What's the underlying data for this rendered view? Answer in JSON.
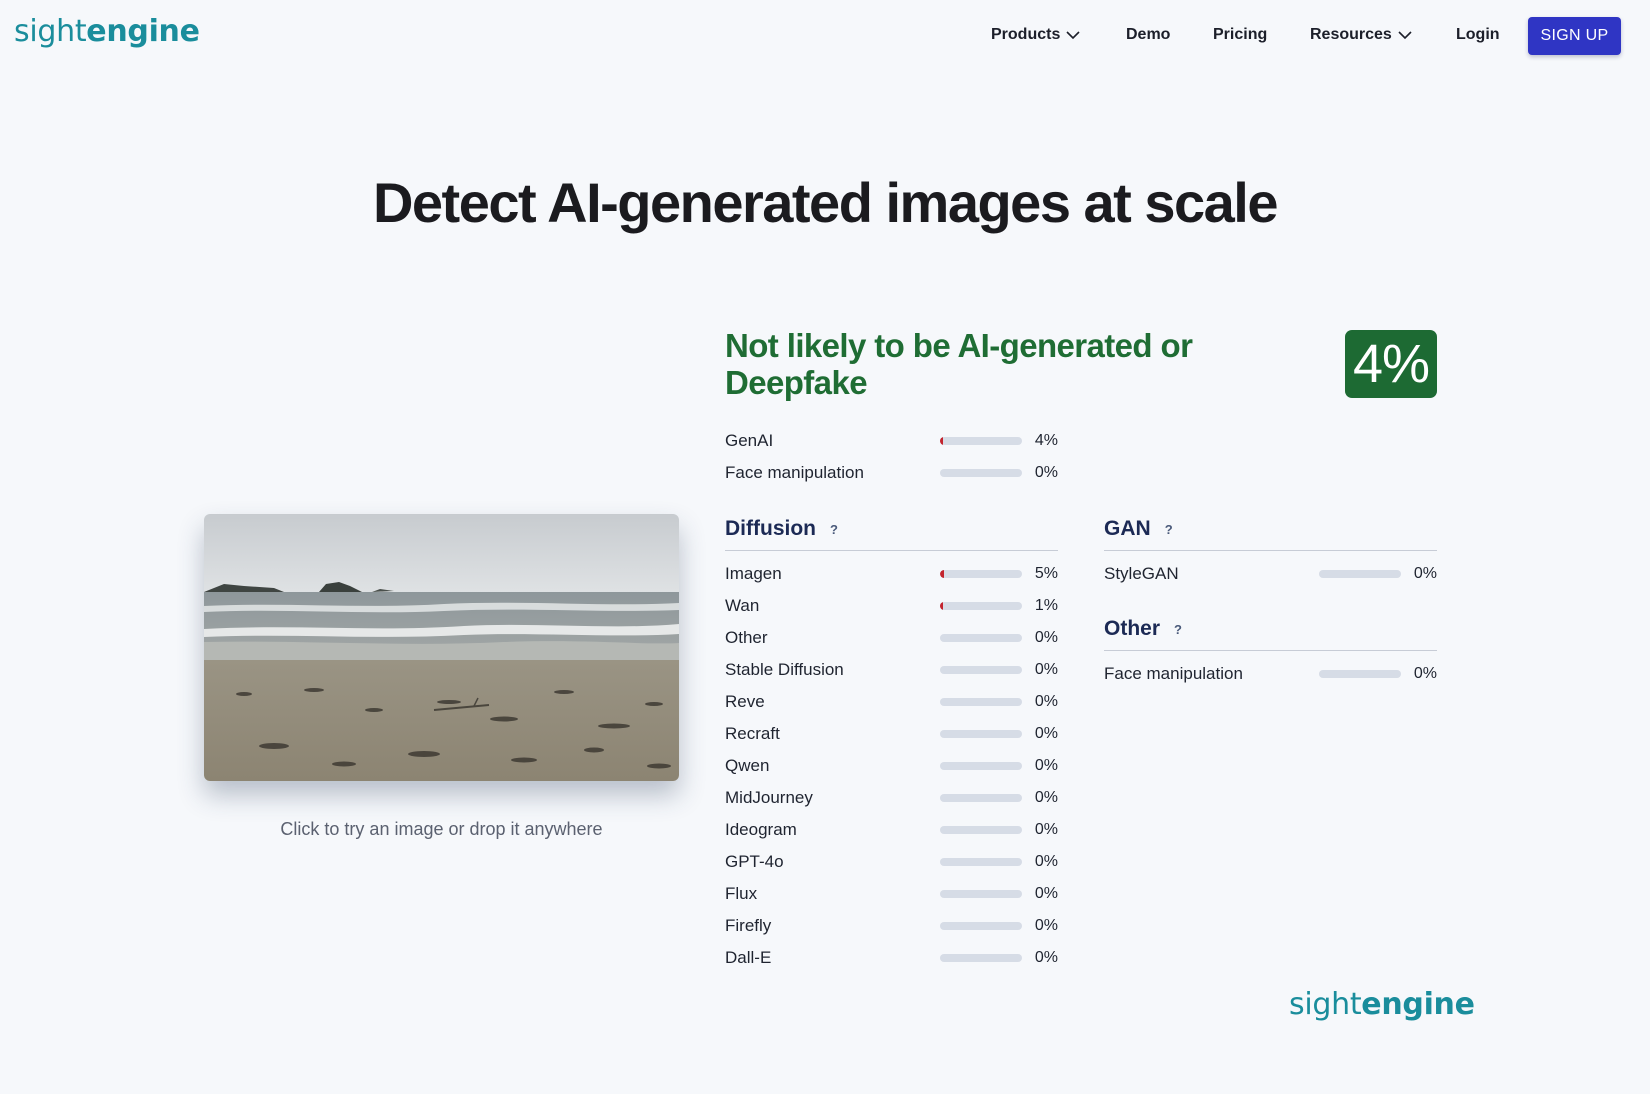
{
  "brand": {
    "logo_part1": "sight",
    "logo_part2": "engine"
  },
  "nav": {
    "products": "Products",
    "demo": "Demo",
    "pricing": "Pricing",
    "resources": "Resources",
    "login": "Login",
    "signup": "SIGN UP"
  },
  "hero": {
    "title": "Detect AI-generated images at scale"
  },
  "upload": {
    "caption": "Click to try an image or drop it anywhere"
  },
  "result": {
    "verdict": "Not likely to be AI-generated or Deepfake",
    "score": "4%",
    "verdict_color": "#1f6d34",
    "summary": [
      {
        "label": "GenAI",
        "pct": "4%",
        "value": 0.04
      },
      {
        "label": "Face manipulation",
        "pct": "0%",
        "value": 0
      }
    ],
    "diffusion": {
      "title": "Diffusion",
      "help": "?",
      "items": [
        {
          "label": "Imagen",
          "pct": "5%",
          "value": 0.05
        },
        {
          "label": "Wan",
          "pct": "1%",
          "value": 0.01
        },
        {
          "label": "Other",
          "pct": "0%",
          "value": 0
        },
        {
          "label": "Stable Diffusion",
          "pct": "0%",
          "value": 0
        },
        {
          "label": "Reve",
          "pct": "0%",
          "value": 0
        },
        {
          "label": "Recraft",
          "pct": "0%",
          "value": 0
        },
        {
          "label": "Qwen",
          "pct": "0%",
          "value": 0
        },
        {
          "label": "MidJourney",
          "pct": "0%",
          "value": 0
        },
        {
          "label": "Ideogram",
          "pct": "0%",
          "value": 0
        },
        {
          "label": "GPT-4o",
          "pct": "0%",
          "value": 0
        },
        {
          "label": "Flux",
          "pct": "0%",
          "value": 0
        },
        {
          "label": "Firefly",
          "pct": "0%",
          "value": 0
        },
        {
          "label": "Dall-E",
          "pct": "0%",
          "value": 0
        }
      ]
    },
    "gan": {
      "title": "GAN",
      "help": "?",
      "items": [
        {
          "label": "StyleGAN",
          "pct": "0%",
          "value": 0
        }
      ]
    },
    "other": {
      "title": "Other",
      "help": "?",
      "items": [
        {
          "label": "Face manipulation",
          "pct": "0%",
          "value": 0
        }
      ]
    }
  },
  "colors": {
    "accent": "#2f35c4",
    "brand": "#1a8d9c",
    "bar_fill": "#c3242e",
    "bar_track": "#d6dce6",
    "badge": "#1d6a33"
  }
}
